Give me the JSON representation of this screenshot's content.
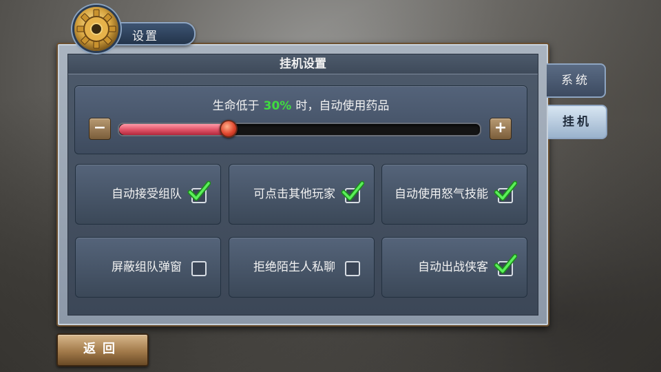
{
  "header": {
    "title": "设置",
    "icon": "gear-icon"
  },
  "panel": {
    "title": "挂机设置"
  },
  "slider": {
    "prefix": "生命低于",
    "value_text": "30%",
    "suffix": "时，自动使用药品",
    "value_fraction": 0.3,
    "minus_label": "−",
    "plus_label": "+"
  },
  "options": [
    {
      "label": "自动接受组队",
      "checked": true
    },
    {
      "label": "可点击其他玩家",
      "checked": true
    },
    {
      "label": "自动使用怒气技能",
      "checked": true
    },
    {
      "label": "屏蔽组队弹窗",
      "checked": false
    },
    {
      "label": "拒绝陌生人私聊",
      "checked": false
    },
    {
      "label": "自动出战侠客",
      "checked": true
    }
  ],
  "tabs": [
    {
      "label": "系统",
      "active": false
    },
    {
      "label": "挂机",
      "active": true
    }
  ],
  "back_button": {
    "label": "返回"
  },
  "colors": {
    "accent_green": "#3fdc3f",
    "slider_fill": "#e2566a"
  }
}
